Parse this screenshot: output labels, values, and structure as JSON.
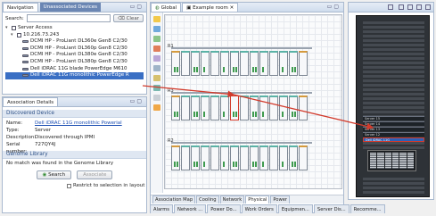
{
  "nav": {
    "tabs": [
      "Navigation",
      "Unassociated Devices"
    ],
    "search_label": "Search:",
    "clear_label": "Clear",
    "tree": [
      {
        "label": "Server Access",
        "level": 0,
        "twist": "▾",
        "icon": "group"
      },
      {
        "label": "10.216.73.243",
        "level": 1,
        "twist": "▾",
        "icon": "group"
      },
      {
        "label": "DCMI HP - ProLiant DL360e Gen8 C2/30",
        "level": 2,
        "icon": "server"
      },
      {
        "label": "DCMI HP - ProLiant DL360p Gen8 C2/30",
        "level": 2,
        "icon": "server"
      },
      {
        "label": "DCMI HP - ProLiant DL380e Gen8 C2/30",
        "level": 2,
        "icon": "server"
      },
      {
        "label": "DCMI HP - ProLiant DL380p Gen8 C2/30",
        "level": 2,
        "icon": "server"
      },
      {
        "label": "Dell iDRAC 11G blade PowerEdge M610",
        "level": 2,
        "icon": "server"
      },
      {
        "label": "Dell iDRAC 11G monolithic PowerEdge R",
        "level": 2,
        "icon": "server",
        "selected": true
      }
    ]
  },
  "details": {
    "title": "Association Details",
    "discovered_title": "Discovered Device",
    "fields": [
      {
        "key": "Name:",
        "value": "Dell iDRAC 11G monolithic Powerial",
        "link": true
      },
      {
        "key": "Type:",
        "value": "Server"
      },
      {
        "key": "Description:",
        "value": "Discovered through IPMI"
      },
      {
        "key": "Serial number:",
        "value": "727QY4J"
      }
    ],
    "genome_title": "Genome Library",
    "no_match": "No match was found in the Genome Library",
    "search_button": "Search",
    "associate_button": "Associate",
    "restrict_label": "Restrict to selection in layout"
  },
  "editor": {
    "tabs": [
      "Global",
      "Example room"
    ],
    "row_labels": [
      "R1",
      "R3",
      "R2"
    ],
    "bottom_tabs": [
      "Association Map",
      "Cooling",
      "Network",
      "Physical",
      "Power"
    ],
    "active_bottom_tab": "Physical"
  },
  "rack": {
    "devices": [
      "Server 15",
      "Server 14",
      "Server 13",
      "Server 12",
      "Dell iDRAC 11G"
    ]
  },
  "status_tabs": [
    "Alarms",
    "Network ...",
    "Power Do...",
    "Work Orders",
    "Equipmen...",
    "Server Dis...",
    "Recomme..."
  ],
  "colors": {
    "selection": "#3a6fc4",
    "arrow": "#d23b2c",
    "rack_teal": "#5ab3a6",
    "rack_orange": "#d59a3c",
    "device_green": "#3f9b4f"
  }
}
